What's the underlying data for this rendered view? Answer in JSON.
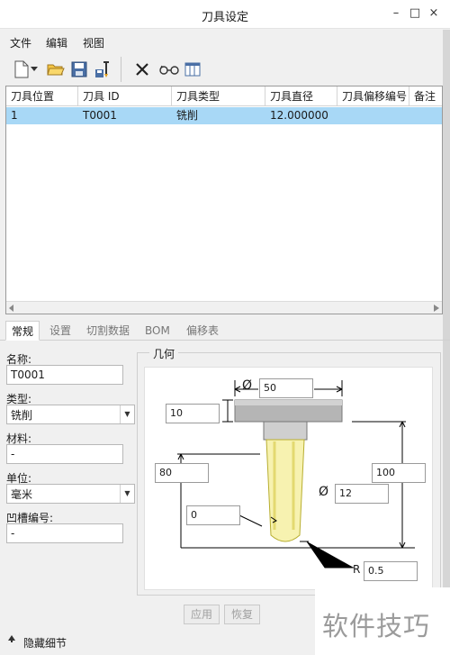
{
  "window": {
    "title": "刀具设定",
    "minimize_glyph": "–",
    "maximize_glyph": "□",
    "close_glyph": "×"
  },
  "menu": {
    "items": [
      "文件",
      "编辑",
      "视图"
    ]
  },
  "toolbar": {
    "icons": [
      "new-file-icon",
      "dropdown-arrow-icon",
      "open-folder-icon",
      "save-icon",
      "save-tool-icon",
      "delete-icon",
      "preview-glasses-icon",
      "table-columns-icon"
    ]
  },
  "table": {
    "headers": [
      "刀具位置",
      "刀具 ID",
      "刀具类型",
      "刀具直径",
      "刀具偏移编号",
      "备注"
    ],
    "rows": [
      [
        "1",
        "T0001",
        "铣削",
        "12.000000",
        "",
        ""
      ]
    ],
    "selected_row_color": "#a8d8f6"
  },
  "tabs": [
    "常规",
    "设置",
    "切割数据",
    "BOM",
    "偏移表"
  ],
  "form": {
    "name_label": "名称:",
    "name_value": "T0001",
    "type_label": "类型:",
    "type_value": "铣削",
    "material_label": "材料:",
    "material_value": "-",
    "unit_label": "单位:",
    "unit_value": "毫米",
    "groove_label": "凹槽编号:",
    "groove_value": "-"
  },
  "geometry": {
    "title": "几何",
    "head_diameter": "50",
    "head_height": "10",
    "flute_length": "80",
    "offset": "0",
    "total_length": "100",
    "cutter_diameter": "12",
    "corner_radius": "0.5",
    "diameter_symbol": "Ø",
    "radius_symbol": "R"
  },
  "buttons": {
    "apply": "应用",
    "restore": "恢复"
  },
  "status": {
    "toggle_label": "隐藏细节",
    "toggle_icon": "up-arrow-icon"
  },
  "watermark": {
    "text": "软件技巧"
  }
}
